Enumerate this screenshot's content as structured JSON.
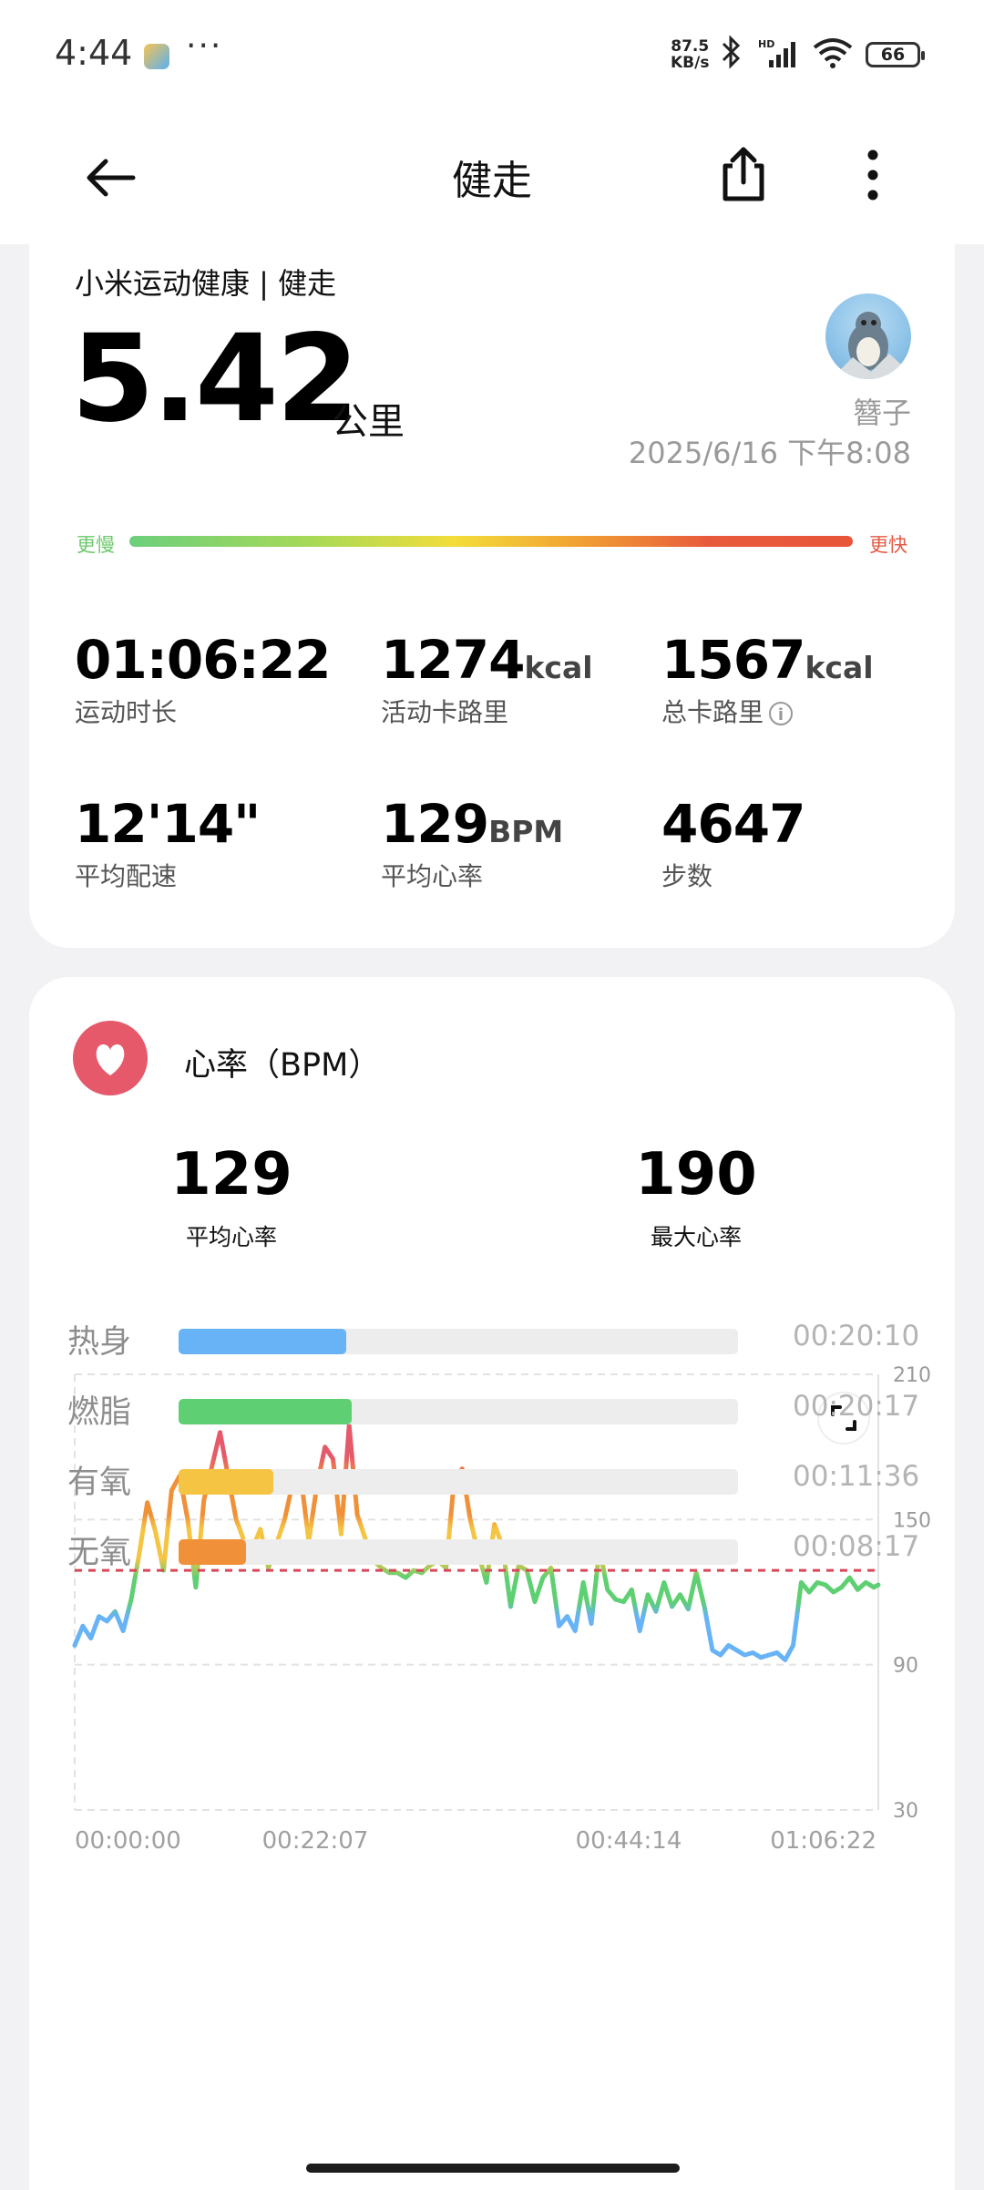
{
  "status_bar": {
    "time": "4:44",
    "dots": "···",
    "net_speed_value": "87.5",
    "net_speed_unit": "KB/s",
    "battery": "66"
  },
  "header": {
    "title": "健走"
  },
  "summary": {
    "source": "小米运动健康 | 健走",
    "distance": "5.42",
    "distance_unit": "公里",
    "user_name": "簪子",
    "datetime": "2025/6/16 下午8:08",
    "slow_label": "更慢",
    "fast_label": "更快",
    "stats": [
      {
        "value": "01:06:22",
        "unit": "",
        "label": "运动时长"
      },
      {
        "value": "1274",
        "unit": "kcal",
        "label": "活动卡路里"
      },
      {
        "value": "1567",
        "unit": "kcal",
        "label": "总卡路里"
      },
      {
        "value": "12'14\"",
        "unit": "",
        "label": "平均配速"
      },
      {
        "value": "129",
        "unit": "BPM",
        "label": "平均心率"
      },
      {
        "value": "4647",
        "unit": "",
        "label": "步数"
      }
    ]
  },
  "heart_rate": {
    "title": "心率（BPM）",
    "avg_value": "129",
    "avg_label": "平均心率",
    "max_value": "190",
    "max_label": "最大心率",
    "zones": [
      {
        "name": "热身",
        "time": "00:20:10",
        "fraction": 0.3,
        "color": "#67b3f5"
      },
      {
        "name": "燃脂",
        "time": "00:20:17",
        "fraction": 0.31,
        "color": "#5ecf72"
      },
      {
        "name": "有氧",
        "time": "00:11:36",
        "fraction": 0.17,
        "color": "#f5c443"
      },
      {
        "name": "无氧",
        "time": "00:08:17",
        "fraction": 0.12,
        "color": "#f0913a"
      }
    ]
  },
  "chart_data": {
    "type": "line",
    "title": "",
    "xlabel": "",
    "ylabel": "",
    "ylim": [
      30,
      210
    ],
    "y_ticks": [
      "210",
      "150",
      "90",
      "30"
    ],
    "x_ticks": [
      "00:00:00",
      "00:22:07",
      "00:44:14",
      "01:06:22"
    ],
    "x_range_seconds": [
      0,
      3982
    ],
    "average_line": 129,
    "grid": true,
    "zone_colors": {
      "warmup": "#67b3f5",
      "fatburn": "#5ecf72",
      "aerobic": "#f5c443",
      "anaerobic": "#f0913a",
      "max": "#e5596a"
    },
    "series": [
      {
        "x_seconds": [
          0,
          40,
          80,
          120,
          160,
          200,
          240,
          280,
          320,
          360,
          400,
          440,
          480,
          520,
          560,
          600,
          640,
          680,
          720,
          760,
          800,
          840,
          880,
          920,
          960,
          1000,
          1040,
          1080,
          1120,
          1160,
          1200,
          1240,
          1280,
          1320,
          1360,
          1400,
          1440,
          1480,
          1520,
          1560,
          1600,
          1640,
          1680,
          1720,
          1760,
          1800,
          1840,
          1880,
          1920,
          1960,
          2000,
          2040,
          2080,
          2120,
          2160,
          2200,
          2240,
          2280,
          2320,
          2360,
          2400,
          2440,
          2480,
          2520,
          2560,
          2600,
          2640,
          2680,
          2720,
          2760,
          2800,
          2840,
          2880,
          2920,
          2960,
          3000,
          3040,
          3080,
          3120,
          3160,
          3200,
          3240,
          3280,
          3320,
          3360,
          3400,
          3440,
          3480,
          3520,
          3560,
          3600,
          3640,
          3680,
          3720,
          3760,
          3800,
          3840,
          3880,
          3920,
          3960,
          3982
        ],
        "values": [
          98,
          106,
          101,
          110,
          108,
          112,
          104,
          117,
          136,
          157,
          145,
          129,
          162,
          168,
          150,
          122,
          158,
          172,
          186,
          168,
          150,
          141,
          138,
          146,
          130,
          140,
          150,
          165,
          168,
          141,
          164,
          180,
          175,
          144,
          189,
          152,
          142,
          133,
          130,
          128,
          128,
          126,
          129,
          128,
          131,
          133,
          130,
          166,
          171,
          150,
          136,
          124,
          148,
          139,
          114,
          131,
          129,
          116,
          126,
          130,
          106,
          110,
          104,
          124,
          107,
          138,
          121,
          117,
          116,
          121,
          104,
          119,
          112,
          124,
          114,
          119,
          113,
          128,
          114,
          96,
          94,
          98,
          96,
          94,
          95,
          93,
          94,
          95,
          92,
          98,
          124,
          120,
          124,
          123,
          120,
          122,
          126,
          121,
          124,
          122,
          123
        ]
      }
    ]
  }
}
